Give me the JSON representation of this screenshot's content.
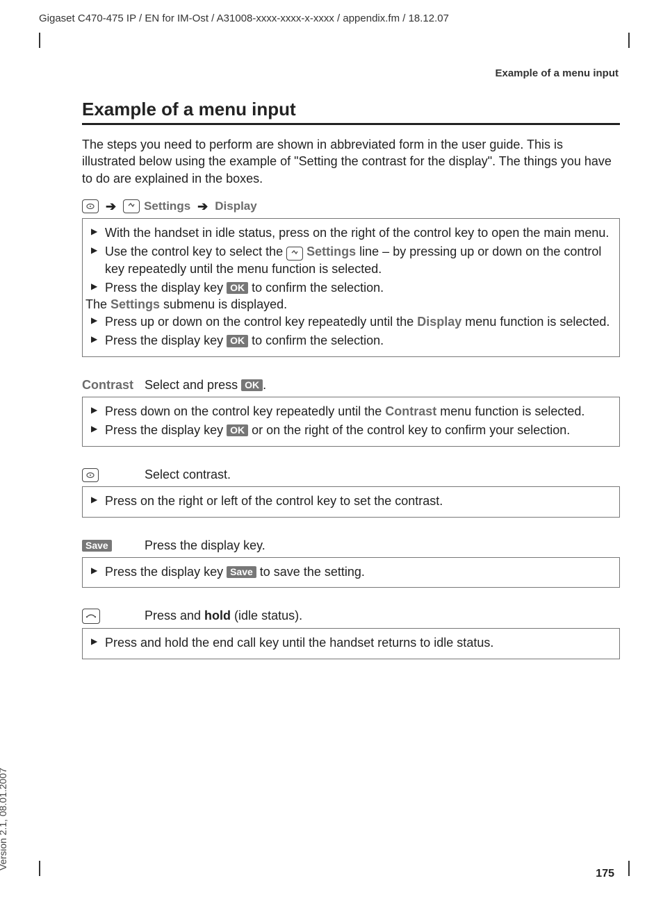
{
  "header": {
    "topline": "Gigaset C470-475 IP / EN for IM-Ost / A31008-xxxx-xxxx-x-xxxx / appendix.fm / 18.12.07",
    "running_head": "Example of a menu input"
  },
  "h1": "Example of a menu input",
  "intro": "The steps you need to perform are shown in abbreviated form in the user guide. This is illustrated below using the example of \"Setting the contrast for the display\". The things you have to do are explained in the boxes.",
  "path": {
    "settings": "Settings",
    "display": "Display"
  },
  "labels": {
    "ok": "OK",
    "save": "Save"
  },
  "box1": {
    "li1": "With the handset in idle status, press on the right of the control key to open the main menu.",
    "li2a": "Use the control key to select the ",
    "li2_settings": " Settings",
    "li2b": " line – by pressing up or down on the control key repeatedly until the menu function is selected.",
    "li3a": "Press the display key ",
    "li3b": " to confirm the selection.",
    "note_a": "The ",
    "note_settings": "Settings",
    "note_b": " submenu is displayed.",
    "li4a": "Press up or down on the control key repeatedly until the ",
    "li4_display": "Display",
    "li4b": " menu function is selected.",
    "li5a": "Press the display key ",
    "li5b": " to confirm the selection."
  },
  "step1": {
    "key": "Contrast",
    "text_a": "Select and press ",
    "text_b": "."
  },
  "box2": {
    "li1a": "Press down on the control key repeatedly until the ",
    "li1_contrast": "Contrast",
    "li1b": " menu function is selected.",
    "li2a": "Press the display key ",
    "li2b": " or on the right of the control key to confirm your selection."
  },
  "step2": {
    "text": "Select contrast."
  },
  "box3": {
    "li1": "Press on the right or left of the control key to set the contrast."
  },
  "step3": {
    "text": "Press the display key."
  },
  "box4": {
    "li1a": "Press the display key ",
    "li1b": " to save the setting."
  },
  "step4": {
    "text_a": "Press and ",
    "text_bold": "hold",
    "text_b": " (idle status)."
  },
  "box5": {
    "li1": "Press and hold the end call key until the handset returns to idle status."
  },
  "page_number": "175",
  "version": "Version 2.1, 08.01.2007"
}
